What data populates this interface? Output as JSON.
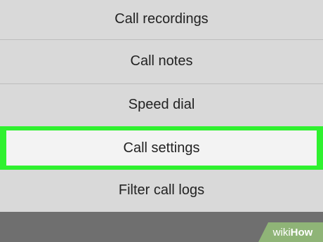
{
  "menu": {
    "items": [
      {
        "label": "Call recordings"
      },
      {
        "label": "Call notes"
      },
      {
        "label": "Speed dial"
      },
      {
        "label": "Call settings"
      },
      {
        "label": "Filter call logs"
      }
    ]
  },
  "branding": {
    "wiki": "wiki",
    "how": "How"
  },
  "colors": {
    "menu_background": "#d9d9d9",
    "highlight_border": "#2ff12f",
    "highlight_fill": "#f3f3f3",
    "text": "#222222",
    "background": "#6f6f6f",
    "badge": "#8fb477"
  }
}
